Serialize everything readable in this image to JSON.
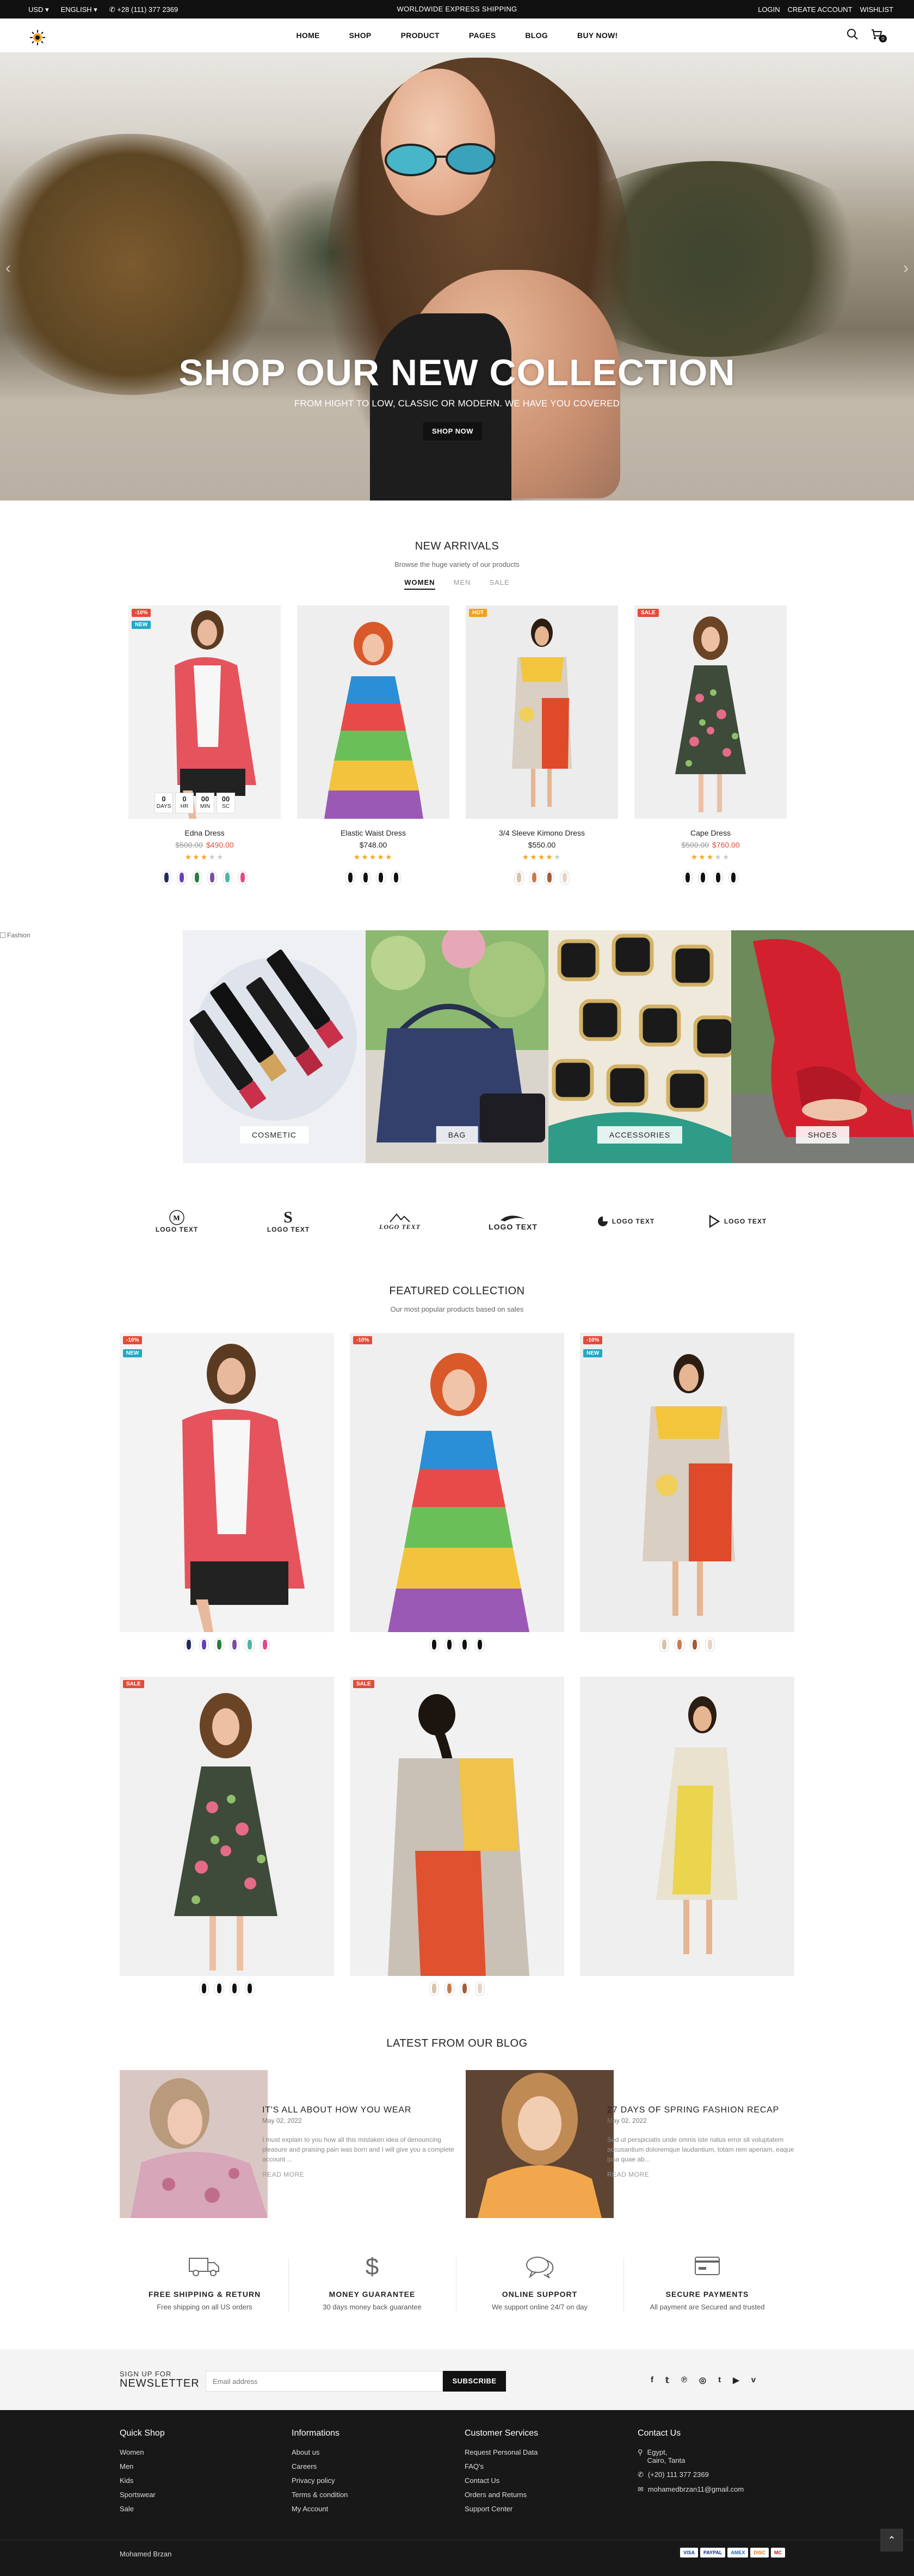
{
  "topbar": {
    "currency": "USD",
    "language": "ENGLISH",
    "phone": "+28 (111) 377 2369",
    "announcement": "WORLDWIDE EXPRESS SHIPPING",
    "links": [
      "LOGIN",
      "CREATE ACCOUNT",
      "WISHLIST"
    ]
  },
  "header": {
    "nav": [
      "HOME",
      "SHOP",
      "PRODUCT",
      "PAGES",
      "BLOG",
      "BUY NOW!"
    ],
    "cart_count": "0"
  },
  "hero": {
    "title": "SHOP OUR NEW COLLECTION",
    "subtitle": "FROM HIGHT TO LOW, CLASSIC OR MODERN. WE HAVE YOU COVERED",
    "button": "SHOP NOW"
  },
  "new_arrivals": {
    "title": "NEW ARRIVALS",
    "subtitle": "Browse the huge variety of our products",
    "tabs": [
      "WOMEN",
      "MEN",
      "SALE"
    ],
    "products": [
      {
        "name": "Edna Dress",
        "old_price": "$500.00",
        "price": "$490.00",
        "rating": 3,
        "badges": [
          "-10%",
          "NEW"
        ],
        "countdown": [
          {
            "v": "0",
            "u": "DAYS"
          },
          {
            "v": "0",
            "u": "HR"
          },
          {
            "v": "00",
            "u": "MIN"
          },
          {
            "v": "00",
            "u": "SC"
          }
        ],
        "swatches": [
          "#1f2b5a",
          "#6a3fb8",
          "#2a7d3b",
          "#7d4f9e",
          "#4cb6a8",
          "#e5478b"
        ]
      },
      {
        "name": "Elastic Waist Dress",
        "old_price": "",
        "price": "$748.00",
        "rating": 5,
        "badges": [],
        "swatches": [
          "#111111",
          "#111111",
          "#111111",
          "#111111"
        ]
      },
      {
        "name": "3/4 Sleeve Kimono Dress",
        "old_price": "",
        "price": "$550.00",
        "rating": 4,
        "badges": [
          "HOT"
        ],
        "swatches": [
          "#d9c2a6",
          "#c77b4e",
          "#a35b3a",
          "#e6d3c5"
        ]
      },
      {
        "name": "Cape Dress",
        "old_price": "$500.00",
        "price": "$760.00",
        "rating": 3,
        "badges": [
          "SALE"
        ],
        "swatches": [
          "#111111",
          "#111111",
          "#111111",
          "#111111"
        ]
      }
    ]
  },
  "categories": {
    "broken_image_alt": "Fashion",
    "items": [
      "COSMETIC",
      "BAG",
      "ACCESSORIES",
      "SHOES"
    ]
  },
  "brands": [
    "LOGO TEXT",
    "LOGO TEXT",
    "LOGO TEXT",
    "LOGO TEXT",
    "LOGO TEXT",
    "LOGO TEXT"
  ],
  "featured": {
    "title": "FEATURED COLLECTION",
    "subtitle": "Our most popular products based on sales",
    "items": [
      {
        "badges": [
          "-10%",
          "NEW"
        ],
        "swatches": [
          "#1f2b5a",
          "#6a3fb8",
          "#2a7d3b",
          "#7d4f9e",
          "#4cb6a8",
          "#e5478b"
        ]
      },
      {
        "badges": [
          "-10%"
        ],
        "swatches": [
          "#111111",
          "#111111",
          "#111111",
          "#111111"
        ]
      },
      {
        "badges": [
          "-10%",
          "NEW"
        ],
        "swatches": [
          "#d9c2a6",
          "#c77b4e",
          "#a35b3a",
          "#e6d3c5"
        ]
      },
      {
        "badges": [
          "SALE"
        ],
        "swatches": [
          "#111111",
          "#111111",
          "#111111",
          "#111111"
        ]
      },
      {
        "badges": [
          "SALE"
        ],
        "swatches": [
          "#d9c2a6",
          "#c77b4e",
          "#a35b3a",
          "#e6d3c5"
        ]
      },
      {
        "badges": [],
        "swatches": []
      }
    ]
  },
  "blog": {
    "title": "LATEST FROM OUR BLOG",
    "posts": [
      {
        "title": "IT'S ALL ABOUT HOW YOU WEAR",
        "date": "May 02, 2022",
        "text": "I must explain to you how all this mistaken idea of denouncing pleasure and praising pain was born and I will give you a complete account ...",
        "more": "READ MORE"
      },
      {
        "title": "27 DAYS OF SPRING FASHION RECAP",
        "date": "May 02, 2022",
        "text": "Sed ut perspiciatis unde omnis iste natus error sit voluptatem accusantium doloremque laudantium, totam rem aperiam, eaque ipsa quae ab...",
        "more": "READ MORE"
      }
    ]
  },
  "services": [
    {
      "icon": "truck-icon",
      "title": "FREE SHIPPING & RETURN",
      "desc": "Free shipping on all US orders"
    },
    {
      "icon": "dollar-icon",
      "title": "MONEY GUARANTEE",
      "desc": "30 days money back guarantee"
    },
    {
      "icon": "chat-icon",
      "title": "ONLINE SUPPORT",
      "desc": "We support online 24/7 on day"
    },
    {
      "icon": "payment-icon",
      "title": "SECURE PAYMENTS",
      "desc": "All payment are Secured and trusted"
    }
  ],
  "newsletter": {
    "small": "SIGN UP FOR",
    "big": "NEWSLETTER",
    "placeholder": "Email address",
    "button": "SUBSCRIBE",
    "social": [
      "facebook-icon",
      "twitter-icon",
      "pinterest-icon",
      "instagram-icon",
      "tumblr-icon",
      "youtube-icon",
      "vimeo-icon"
    ]
  },
  "footer": {
    "columns": [
      {
        "title": "Quick Shop",
        "items": [
          "Women",
          "Men",
          "Kids",
          "Sportswear",
          "Sale"
        ]
      },
      {
        "title": "Informations",
        "items": [
          "About us",
          "Careers",
          "Privacy policy",
          "Terms & condition",
          "My Account"
        ]
      },
      {
        "title": "Customer Services",
        "items": [
          "Request Personal Data",
          "FAQ's",
          "Contact Us",
          "Orders and Returns",
          "Support Center"
        ]
      }
    ],
    "contact": {
      "title": "Contact Us",
      "address_line1": "Egypt,",
      "address_line2": "Cairo, Tanta",
      "phone": "(+20) 111 377 2369",
      "email": "mohamedbrzan11@gmail.com"
    },
    "copyright": "Mohamed Brzan",
    "payments": [
      "VISA",
      "PAYPAL",
      "AMEX",
      "DISC",
      "MC"
    ]
  },
  "colors": {
    "accent": "#e24c3a",
    "new_badge": "#1fa9c6",
    "hot_badge": "#f0a21e",
    "star": "#f5a623",
    "dark": "#111111"
  }
}
